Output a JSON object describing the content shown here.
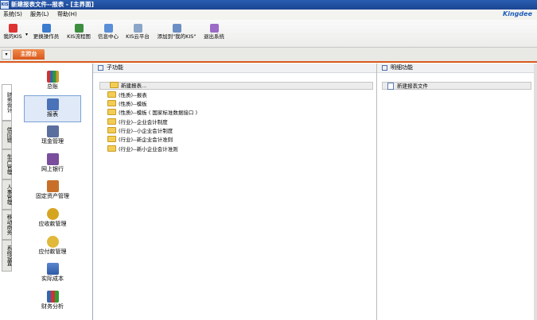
{
  "window": {
    "title": "新建报表文件--报表 - [主界面]",
    "icon_text": "KIS"
  },
  "menu": {
    "items": [
      "系统(S)",
      "服务(L)",
      "帮助(H)"
    ],
    "brand": "Kingdee"
  },
  "toolbar": {
    "buttons": [
      {
        "label": "我的KIS"
      },
      {
        "label": "更换操作员"
      },
      {
        "label": "KIS流程图"
      },
      {
        "label": "信息中心"
      },
      {
        "label": "KIS云平台"
      },
      {
        "label": "添加到\"我的KIS\""
      },
      {
        "label": "退出系统"
      }
    ]
  },
  "tabs": {
    "dropdown": "▾",
    "active": "主控台"
  },
  "vertical_tabs": [
    "财务会计",
    "供应链",
    "生产管理",
    "人事管理",
    "移动商务",
    "系统设置"
  ],
  "nav": {
    "items": [
      {
        "label": "总账"
      },
      {
        "label": "报表"
      },
      {
        "label": "现金管理"
      },
      {
        "label": "网上银行"
      },
      {
        "label": "固定资产管理"
      },
      {
        "label": "应收款管理"
      },
      {
        "label": "应付款管理"
      },
      {
        "label": "实际成本"
      },
      {
        "label": "财务分析"
      }
    ],
    "selected": "报表"
  },
  "sub_panel": {
    "header": "子功能",
    "top_item": "新建报表...",
    "folders": [
      "(性质)--报表",
      "(性质)--模板",
      "(性质)--模板 ( 国家标准数据接口 )",
      "(行业)--企业会计制度",
      "(行业)--小企业会计制度",
      "(行业)--新企业会计准则",
      "(行业)--新小企业会计准则"
    ]
  },
  "detail_panel": {
    "header": "明细功能",
    "item": "新建报表文件"
  },
  "colors": {
    "title_bar": "#1b4592",
    "accent_orange": "#d9581c",
    "brand_blue": "#1e5db8",
    "folder": "#f2cd55"
  }
}
